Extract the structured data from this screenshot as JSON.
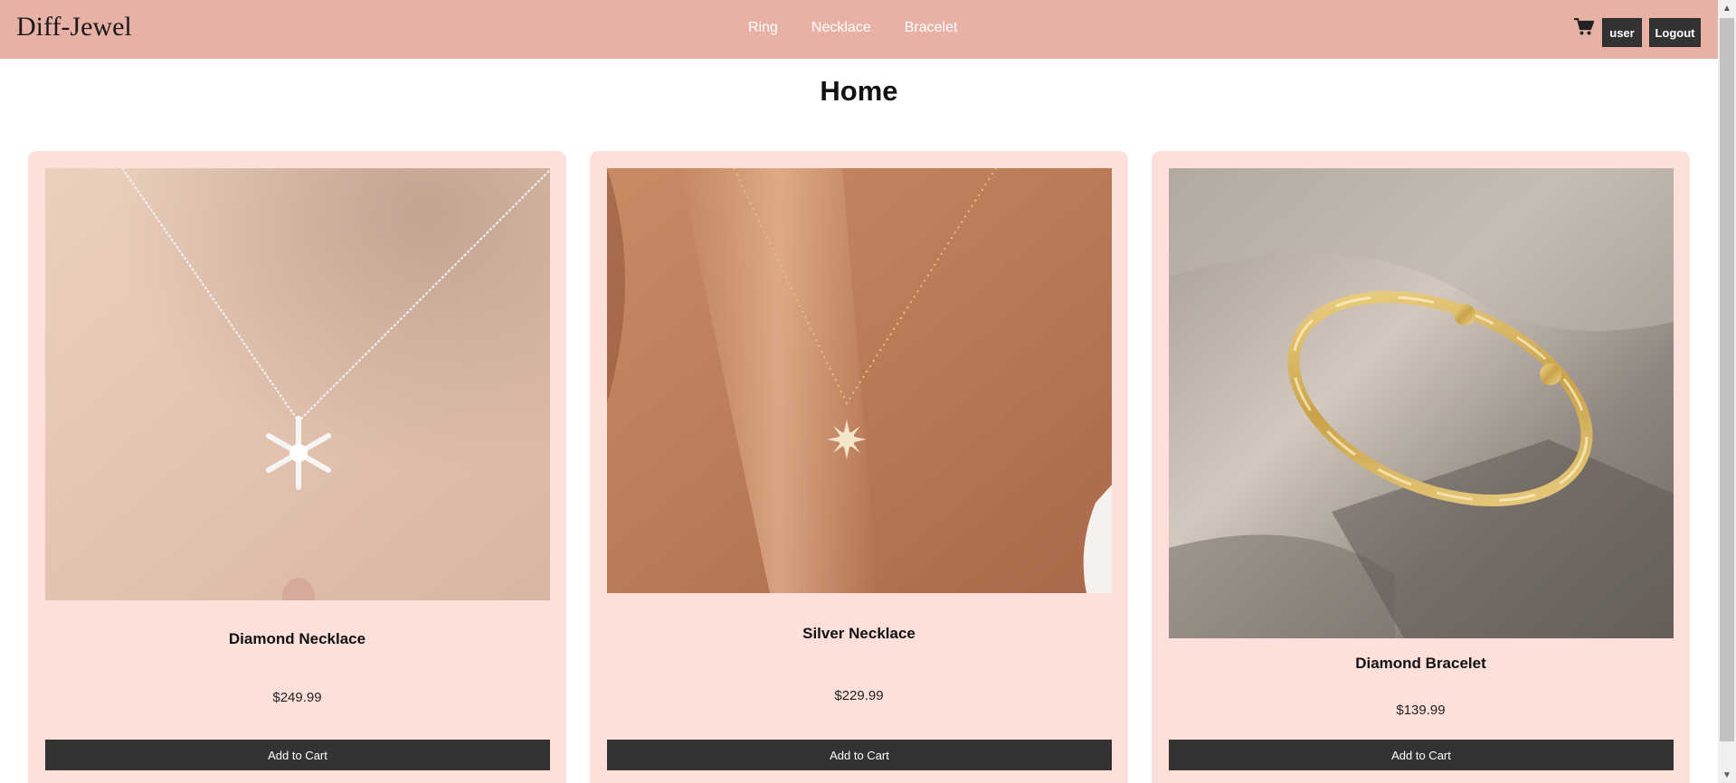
{
  "header": {
    "brand": "Diff-Jewel",
    "nav": [
      "Ring",
      "Necklace",
      "Bracelet"
    ],
    "cart_icon": "cart-icon",
    "user_label": "user",
    "logout_label": "Logout"
  },
  "page": {
    "title": "Home"
  },
  "products": [
    {
      "name": "Diamond Necklace",
      "price": "$249.99",
      "button": "Add to Cart",
      "image": "snowflake-necklace-photo"
    },
    {
      "name": "Silver Necklace",
      "price": "$229.99",
      "button": "Add to Cart",
      "image": "sun-pendant-necklace-photo"
    },
    {
      "name": "Diamond Bracelet",
      "price": "$139.99",
      "button": "Add to Cart",
      "image": "gold-twist-bracelet-photo"
    }
  ],
  "colors": {
    "header_bg": "#e8b1a6",
    "card_bg": "#fde0d9",
    "button_bg": "#333333"
  }
}
